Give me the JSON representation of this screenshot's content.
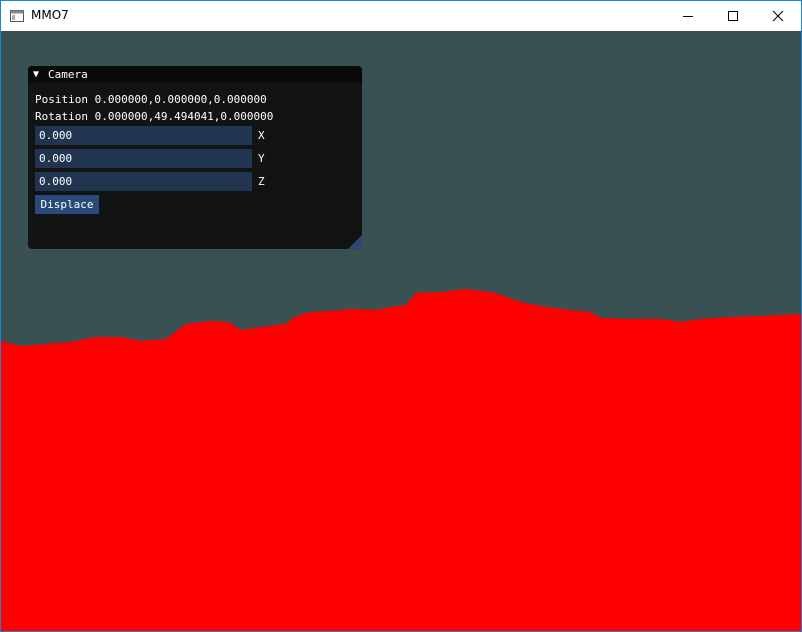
{
  "window": {
    "title": "MMO7",
    "icon": "app-window-icon",
    "controls": [
      "minimize-icon",
      "maximize-icon",
      "close-icon"
    ]
  },
  "colors": {
    "sky": "#3a5153",
    "terrain": "#ff0000",
    "panel_bg": "#101010",
    "field_bg": "#213551",
    "button_bg": "#294a7a"
  },
  "camera_panel": {
    "title": "Camera",
    "position": "Position 0.000000,0.000000,0.000000",
    "rotation": "Rotation 0.000000,49.494041,0.000000",
    "inputs": [
      {
        "value": "0.000",
        "label": "X"
      },
      {
        "value": "0.000",
        "label": "Y"
      },
      {
        "value": "0.000",
        "label": "Z"
      }
    ],
    "button_label": "Displace"
  }
}
